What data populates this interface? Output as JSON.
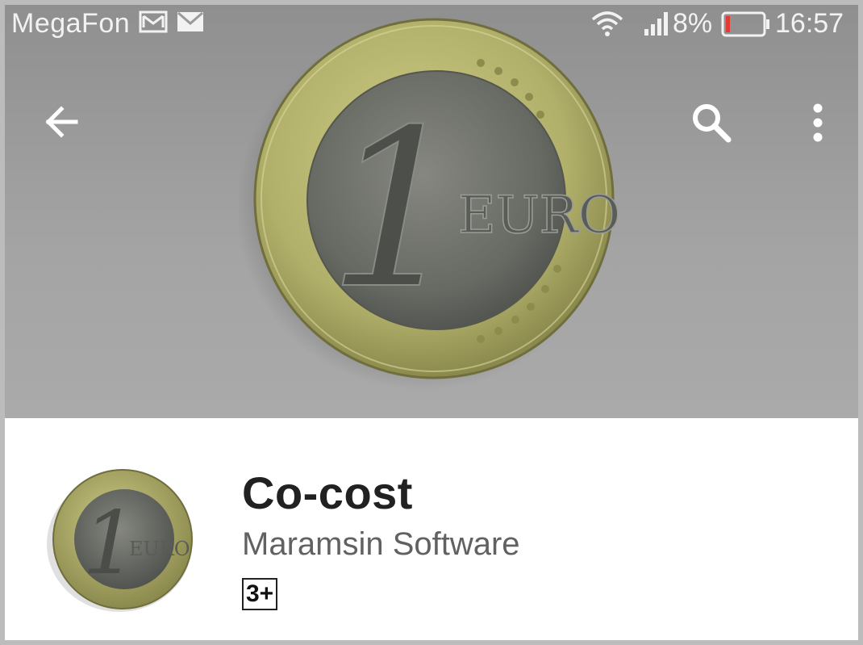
{
  "status_bar": {
    "carrier": "MegaFon",
    "battery_percent": "8%",
    "time": "16:57",
    "icons": [
      "gmail-icon",
      "mail-icon",
      "wifi-icon",
      "signal-icon",
      "battery-icon"
    ]
  },
  "app_bar": {
    "icons": [
      "back-arrow-icon",
      "search-icon",
      "more-vert-icon"
    ]
  },
  "hero": {
    "coin_text": "1 EURO"
  },
  "app": {
    "title": "Co-cost",
    "developer": "Maramsin Software",
    "content_rating": "3+"
  },
  "colors": {
    "hero_background": "#9c9c9c",
    "battery_low": "#e53935",
    "title_text": "#212121",
    "developer_text": "#616161",
    "coin_ring": "#b5b46a",
    "coin_center": "#6a6c66"
  }
}
